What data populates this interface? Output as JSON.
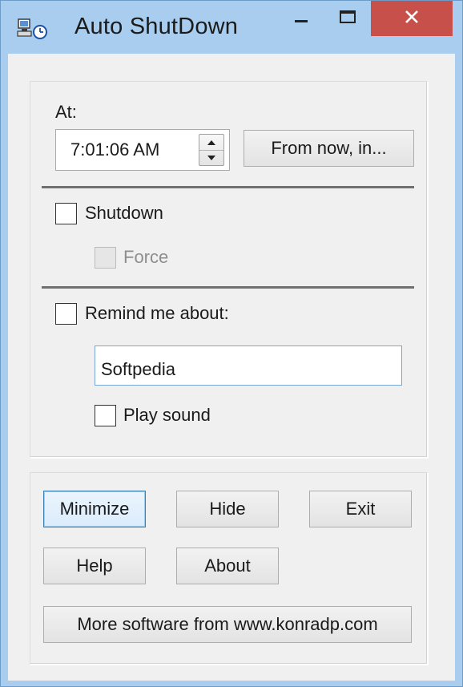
{
  "window": {
    "title": "Auto ShutDown",
    "accent": "#a8cdee",
    "close_color": "#c7504a",
    "icon": "app-clock-icon"
  },
  "controls": {
    "minimize_icon": "window-minimize-icon",
    "maximize_icon": "window-maximize-icon",
    "close_icon": "window-close-icon"
  },
  "schedule": {
    "at_label": "At:",
    "time_value": "7:01:06 AM",
    "from_now_label": "From now, in..."
  },
  "shutdown": {
    "label": "Shutdown",
    "checked": false,
    "force_label": "Force",
    "force_enabled": false
  },
  "reminder": {
    "label": "Remind me about:",
    "checked": false,
    "message_value": "Softpedia",
    "play_sound_label": "Play sound",
    "play_sound_checked": false
  },
  "buttons": {
    "minimize": "Minimize",
    "hide": "Hide",
    "exit": "Exit",
    "help": "Help",
    "about": "About",
    "more_software": "More software from www.konradp.com"
  }
}
